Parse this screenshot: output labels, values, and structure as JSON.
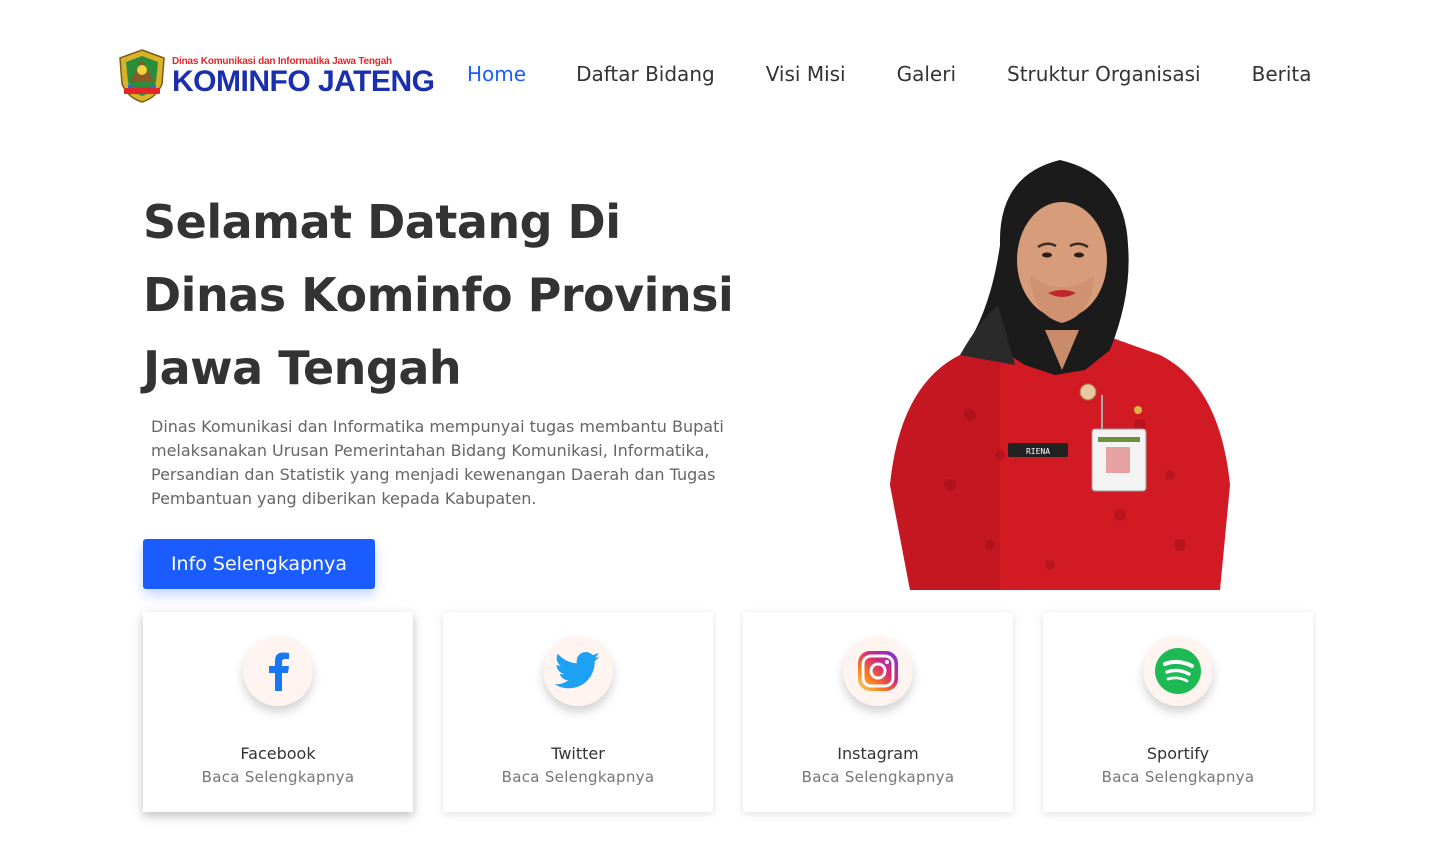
{
  "header": {
    "logo_subtitle": "Dinas Komunikasi dan Informatika Jawa Tengah",
    "logo_title": "KOMINFO JATENG",
    "nav": [
      {
        "label": "Home",
        "active": true
      },
      {
        "label": "Daftar Bidang",
        "active": false
      },
      {
        "label": "Visi Misi",
        "active": false
      },
      {
        "label": "Galeri",
        "active": false
      },
      {
        "label": "Struktur Organisasi",
        "active": false
      },
      {
        "label": "Berita",
        "active": false
      }
    ]
  },
  "hero": {
    "title_lines": [
      "Selamat Datang Di",
      "Dinas Kominfo Provinsi",
      "Jawa Tengah"
    ],
    "description_lines": [
      "Dinas Komunikasi dan Informatika mempunyai tugas membantu Bupati",
      "melaksanakan Urusan Pemerintahan Bidang Komunikasi, Informatika,",
      "Persandian dan Statistik yang menjadi kewenangan Daerah dan Tugas",
      "Pembantuan yang diberikan kepada Kabupaten."
    ],
    "button_label": "Info Selengkapnya",
    "badge_name": "RIENA"
  },
  "cards": [
    {
      "title": "Facebook",
      "link": "Baca Selengkapnya",
      "icon": "facebook-icon",
      "color": "#1877f2"
    },
    {
      "title": "Twitter",
      "link": "Baca Selengkapnya",
      "icon": "twitter-icon",
      "color": "#1da1f2"
    },
    {
      "title": "Instagram",
      "link": "Baca Selengkapnya",
      "icon": "instagram-icon",
      "color": "#c13584"
    },
    {
      "title": "Sportify",
      "link": "Baca Selengkapnya",
      "icon": "spotify-icon",
      "color": "#1db954"
    }
  ],
  "colors": {
    "accent": "#1a5cff",
    "logo_red": "#e3262b",
    "logo_blue": "#1a2fb0",
    "card_icon_bg": "#fff4f0"
  }
}
